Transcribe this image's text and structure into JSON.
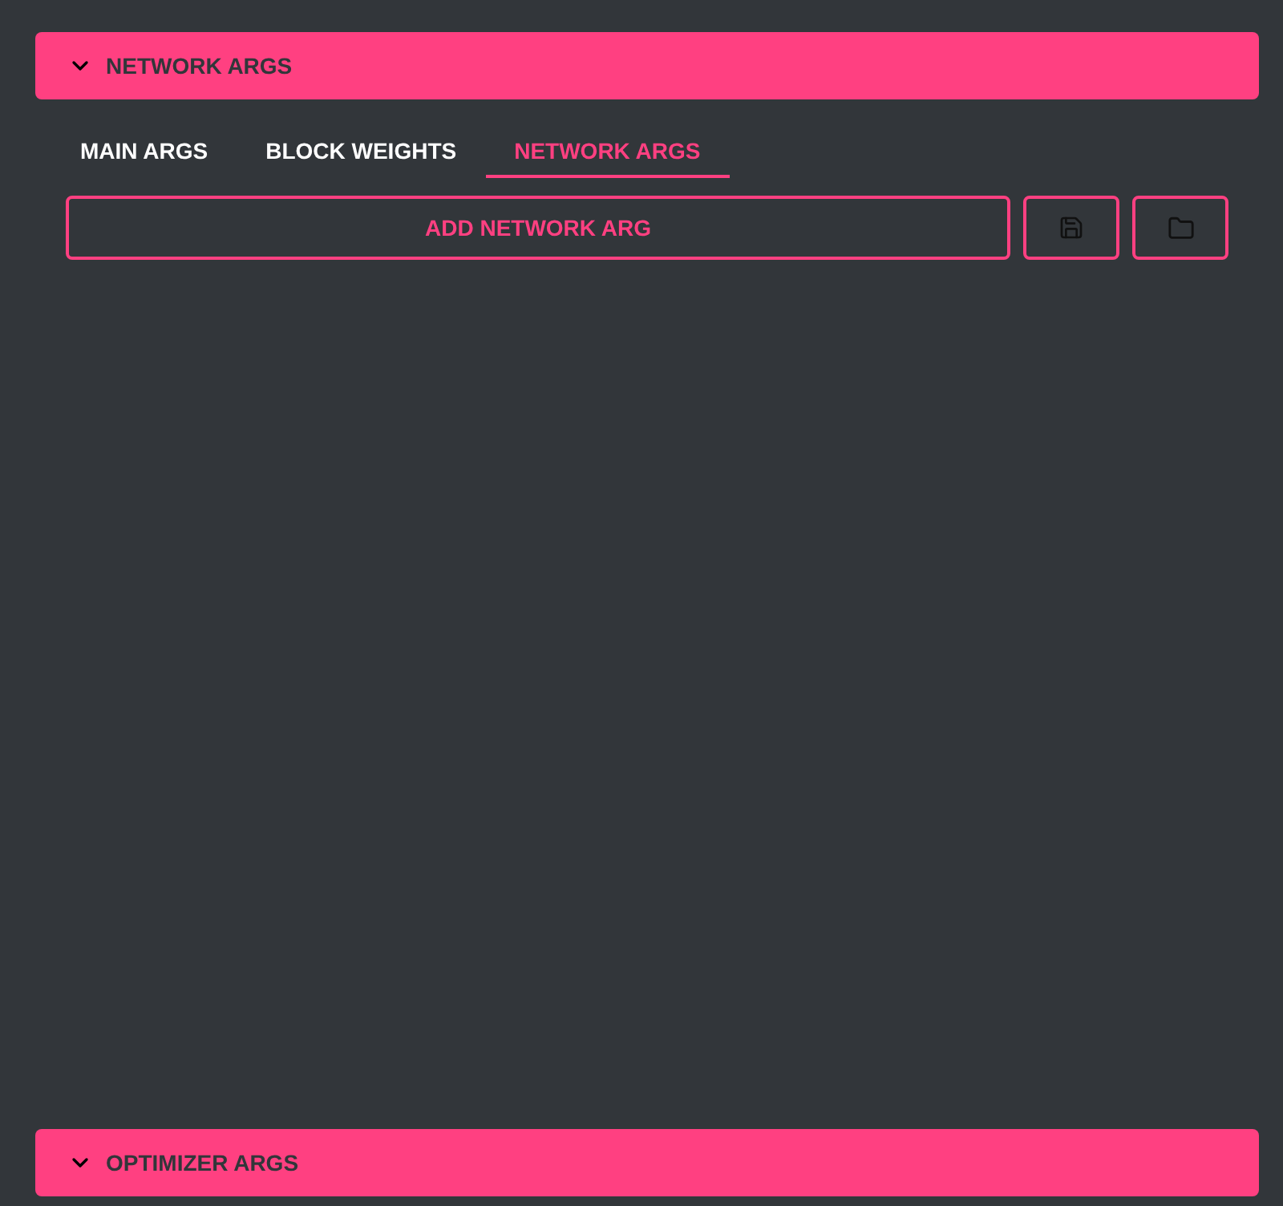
{
  "sections": [
    {
      "title": "NETWORK ARGS",
      "tabs": [
        {
          "label": "MAIN ARGS",
          "selected": false
        },
        {
          "label": "BLOCK WEIGHTS",
          "selected": false
        },
        {
          "label": "NETWORK ARGS",
          "selected": true
        }
      ],
      "add_button": "ADD NETWORK ARG"
    },
    {
      "title": "OPTIMIZER ARGS"
    }
  ]
}
